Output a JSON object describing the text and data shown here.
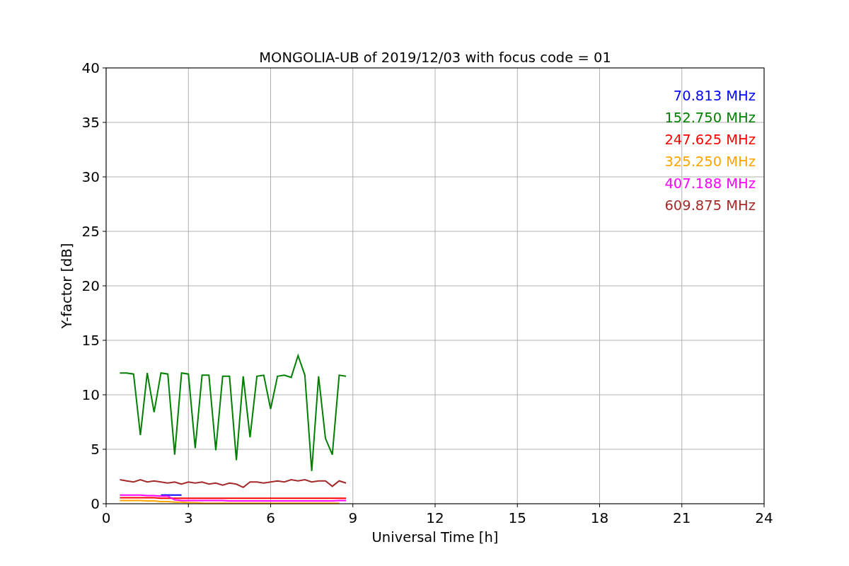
{
  "figure": {
    "chart_data": {
      "type": "line",
      "title": "MONGOLIA-UB of 2019/12/03 with focus code = 01",
      "xlabel": "Universal Time [h]",
      "ylabel": "Y-factor [dB]",
      "xlim": [
        0,
        24
      ],
      "ylim": [
        0,
        40
      ],
      "xticks": [
        0,
        3,
        6,
        9,
        12,
        15,
        18,
        21,
        24
      ],
      "yticks": [
        0,
        5,
        10,
        15,
        20,
        25,
        30,
        35,
        40
      ],
      "grid": true,
      "x": [
        0.5,
        0.75,
        1,
        1.25,
        1.5,
        1.75,
        2,
        2.25,
        2.5,
        2.75,
        3,
        3.25,
        3.5,
        3.75,
        4,
        4.25,
        4.5,
        4.75,
        5,
        5.25,
        5.5,
        5.75,
        6,
        6.25,
        6.5,
        6.75,
        7,
        7.25,
        7.5,
        7.75,
        8,
        8.25,
        8.5,
        8.75
      ],
      "series": [
        {
          "name": "70.813 MHz",
          "color": "#0000ff",
          "values": [
            null,
            null,
            null,
            null,
            null,
            null,
            0.8,
            0.8,
            0.8,
            0.8,
            null,
            null,
            null,
            null,
            null,
            null,
            null,
            null,
            null,
            null,
            null,
            null,
            null,
            null,
            null,
            null,
            null,
            null,
            null,
            null,
            null,
            null,
            null,
            null
          ]
        },
        {
          "name": "152.750 MHz",
          "color": "#008000",
          "values": [
            12,
            12,
            11.9,
            6.3,
            12,
            8.4,
            12,
            11.9,
            4.5,
            12,
            11.9,
            5.1,
            11.8,
            11.8,
            4.9,
            11.7,
            11.7,
            4,
            11.7,
            6.1,
            11.7,
            11.8,
            8.7,
            11.7,
            11.8,
            11.6,
            13.6,
            11.8,
            3,
            11.7,
            6,
            4.5,
            11.8,
            11.7
          ]
        },
        {
          "name": "247.625 MHz",
          "color": "#ff0000",
          "values": [
            0.55,
            0.55,
            0.55,
            0.55,
            0.55,
            0.55,
            0.5,
            0.5,
            0.5,
            0.5,
            0.5,
            0.5,
            0.5,
            0.5,
            0.5,
            0.5,
            0.5,
            0.5,
            0.5,
            0.5,
            0.5,
            0.5,
            0.5,
            0.5,
            0.5,
            0.5,
            0.5,
            0.5,
            0.5,
            0.5,
            0.5,
            0.5,
            0.5,
            0.5
          ]
        },
        {
          "name": "325.250 MHz",
          "color": "#ffa500",
          "values": [
            0.3,
            0.3,
            0.3,
            0.3,
            0.25,
            0.25,
            0.2,
            0.2,
            0.15,
            0.15,
            0.1,
            0.1,
            0.05,
            0.05,
            0.05,
            0.05,
            0.05,
            0.05,
            0.05,
            0.05,
            0.05,
            0.05,
            0.05,
            0.05,
            0.05,
            0.05,
            0.05,
            0.05,
            0.05,
            0.05,
            0.05,
            0.05,
            0.05,
            null
          ]
        },
        {
          "name": "407.188 MHz",
          "color": "#ff00ff",
          "values": [
            0.8,
            0.8,
            0.8,
            0.8,
            0.75,
            0.75,
            0.7,
            0.7,
            0.35,
            0.3,
            0.3,
            0.3,
            0.3,
            0.3,
            0.3,
            0.3,
            0.25,
            0.25,
            0.25,
            0.25,
            0.25,
            0.25,
            0.25,
            0.25,
            0.25,
            0.25,
            0.25,
            0.25,
            0.25,
            0.25,
            0.25,
            0.25,
            0.3,
            0.3
          ]
        },
        {
          "name": "609.875 MHz",
          "color": "#a52a2a",
          "values": [
            2.2,
            2.1,
            2,
            2.2,
            2,
            2.1,
            2,
            1.9,
            2,
            1.8,
            2,
            1.9,
            2,
            1.8,
            1.9,
            1.7,
            1.9,
            1.8,
            1.5,
            2,
            2,
            1.9,
            2,
            2.1,
            2,
            2.2,
            2.1,
            2.2,
            2,
            2.1,
            2.1,
            1.6,
            2.1,
            1.9
          ]
        }
      ]
    }
  }
}
